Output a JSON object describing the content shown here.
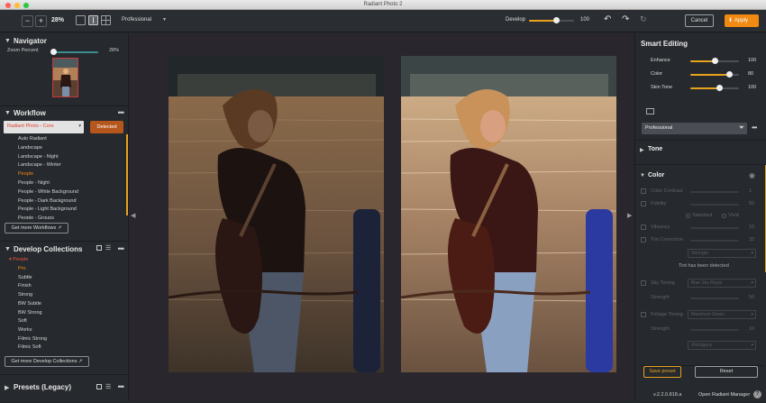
{
  "window": {
    "title": "Radiant Photo 2"
  },
  "toolbar": {
    "minus": "−",
    "plus": "+",
    "zoom": "28%",
    "preset_mode": "Professional",
    "develop_label": "Develop",
    "develop_value": "100",
    "develop_level": 0.6,
    "cancel": "Cancel",
    "apply": "Apply"
  },
  "navigator": {
    "title": "Navigator",
    "zoom_label": "Zoom Percent",
    "zoom_value": "28%"
  },
  "workflow": {
    "title": "Workflow",
    "selected": "Radiant Photo - Core",
    "detected": "Detected",
    "items": [
      "Auto Radiant",
      "Landscape",
      "Landscape - Night",
      "Landscape - Winter",
      "People",
      "People - Night",
      "People - White Background",
      "People - Dark Background",
      "People - Light Background",
      "People - Groups"
    ],
    "active_index": 4,
    "get_more": "Get more Workflows"
  },
  "collections": {
    "title": "Develop Collections",
    "group": "People",
    "items": [
      "Pro",
      "Subtle",
      "Finish",
      "Strong",
      "BW Subtle",
      "BW Strong",
      "Soft",
      "Works",
      "Filmic Strong",
      "Filmic Soft"
    ],
    "active_index": 0,
    "get_more": "Get more Develop Collections"
  },
  "presets_legacy": {
    "title": "Presets (Legacy)"
  },
  "smart": {
    "title": "Smart Editing",
    "sliders": [
      {
        "label": "Enhance",
        "value": "100",
        "level": 0.5
      },
      {
        "label": "Color",
        "value": "80",
        "level": 0.8
      },
      {
        "label": "Skin Tone",
        "value": "100",
        "level": 0.6
      }
    ],
    "preset_select": "Professional"
  },
  "tone": {
    "title": "Tone"
  },
  "color": {
    "title": "Color",
    "rows": [
      {
        "label": "Color Contrast",
        "value": "1"
      },
      {
        "label": "Fidelity",
        "value": "50"
      },
      {
        "label": "Vibrancy",
        "value": "10"
      },
      {
        "label": "Tint Correction",
        "value": "32"
      }
    ],
    "fidelity_opts": [
      "Standard",
      "Vivid"
    ],
    "tint_select": "Stronger",
    "tint_msg": "Tint has been detected",
    "sky": {
      "label": "Sky Toning",
      "select": "Blue Sky Royal",
      "strength_label": "Strength",
      "strength_value": "50"
    },
    "foliage": {
      "label": "Foliage Toning",
      "select": "Maximum Green",
      "strength_label": "Strength",
      "strength_value": "10"
    },
    "extra_select": "Mahogany"
  },
  "footer": {
    "save_preset": "Save preset",
    "reset": "Reset",
    "version": "v.2.2.0.818.a",
    "open_manager": "Open Radiant Manager",
    "help": "?"
  }
}
